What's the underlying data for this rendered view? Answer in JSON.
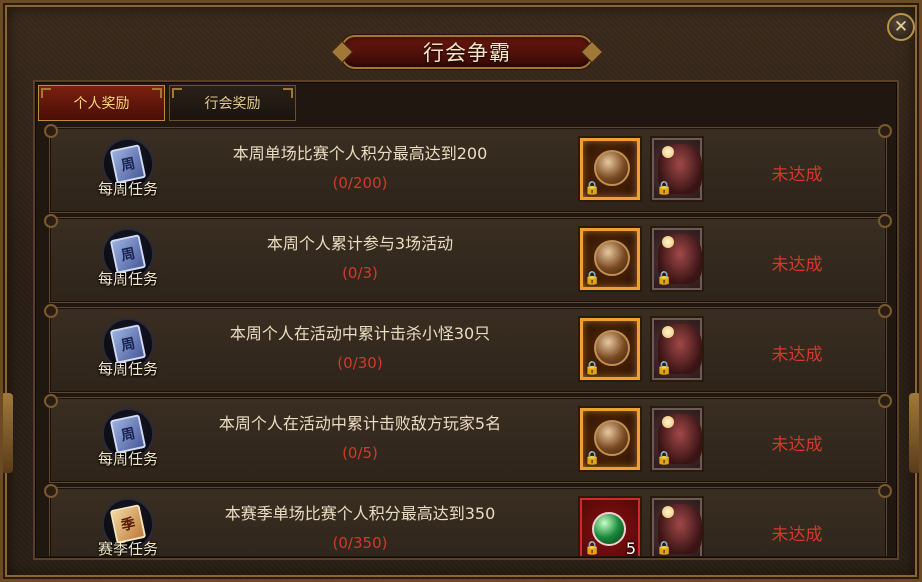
{
  "window": {
    "title": "行会争霸",
    "close_icon": "close-icon"
  },
  "tabs": [
    {
      "label": "个人奖励",
      "active": true
    },
    {
      "label": "行会奖励",
      "active": false
    }
  ],
  "tasks": [
    {
      "type": "每周任务",
      "icon_char": "周",
      "icon": "weekly-medal-icon",
      "desc": "本周单场比赛个人积分最高达到200",
      "progress": "(0/200)",
      "rewards": [
        {
          "icon": "orb-chest-icon",
          "locked": true
        },
        {
          "icon": "beast-mount-icon",
          "locked": true
        }
      ],
      "status": "未达成"
    },
    {
      "type": "每周任务",
      "icon_char": "周",
      "icon": "weekly-medal-icon",
      "desc": "本周个人累计参与3场活动",
      "progress": "(0/3)",
      "rewards": [
        {
          "icon": "orb-chest-icon",
          "locked": true
        },
        {
          "icon": "beast-mount-icon",
          "locked": true
        }
      ],
      "status": "未达成"
    },
    {
      "type": "每周任务",
      "icon_char": "周",
      "icon": "weekly-medal-icon",
      "desc": "本周个人在活动中累计击杀小怪30只",
      "progress": "(0/30)",
      "rewards": [
        {
          "icon": "orb-chest-icon",
          "locked": true
        },
        {
          "icon": "beast-mount-icon",
          "locked": true
        }
      ],
      "status": "未达成"
    },
    {
      "type": "每周任务",
      "icon_char": "周",
      "icon": "weekly-medal-icon",
      "desc": "本周个人在活动中累计击败敌方玩家5名",
      "progress": "(0/5)",
      "rewards": [
        {
          "icon": "orb-chest-icon",
          "locked": true
        },
        {
          "icon": "beast-mount-icon",
          "locked": true
        }
      ],
      "status": "未达成"
    },
    {
      "type": "赛季任务",
      "icon_char": "季",
      "icon": "season-medal-icon",
      "desc": "本赛季单场比赛个人积分最高达到350",
      "progress": "(0/350)",
      "rewards": [
        {
          "icon": "green-gem-icon",
          "locked": true,
          "count": "5"
        },
        {
          "icon": "beast-mount-icon",
          "locked": true
        }
      ],
      "status": "未达成"
    }
  ],
  "colors": {
    "accent_gold": "#f8d878",
    "status_red": "#d23a2a",
    "title_red": "#6a1810"
  }
}
